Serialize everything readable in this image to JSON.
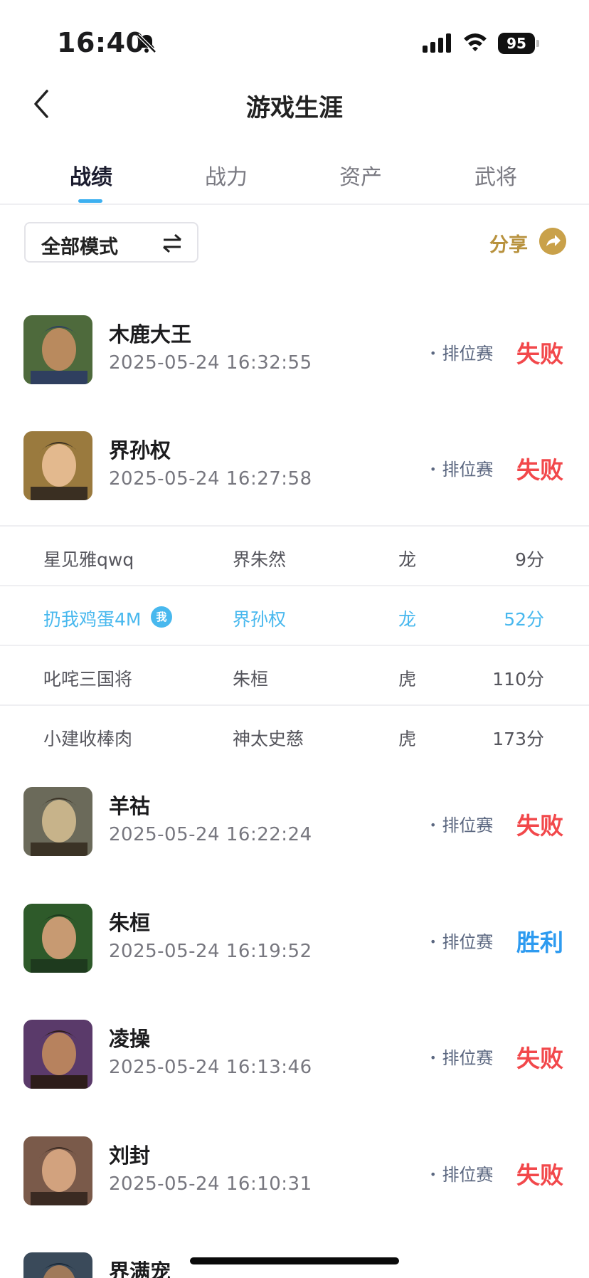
{
  "status_bar": {
    "time": "16:40",
    "battery": "95"
  },
  "header": {
    "title": "游戏生涯"
  },
  "tabs": [
    {
      "label": "战绩",
      "active": true
    },
    {
      "label": "战力",
      "active": false
    },
    {
      "label": "资产",
      "active": false
    },
    {
      "label": "武将",
      "active": false
    }
  ],
  "filter": {
    "mode_label": "全部模式",
    "share_label": "分享"
  },
  "records": [
    {
      "hero": "木鹿大王",
      "datetime": "2025-05-24 16:32:55",
      "match_type": "排位赛",
      "result": "失败",
      "outcome": "lose",
      "avatar_colors": [
        "#4e6a3c",
        "#b98a5e",
        "#2f3f5f"
      ]
    },
    {
      "hero": "界孙权",
      "datetime": "2025-05-24 16:27:58",
      "match_type": "排位赛",
      "result": "失败",
      "outcome": "lose",
      "avatar_colors": [
        "#9a7a3e",
        "#e3b98e",
        "#3a2f22"
      ]
    },
    {
      "hero": "羊祜",
      "datetime": "2025-05-24 16:22:24",
      "match_type": "排位赛",
      "result": "失败",
      "outcome": "lose",
      "avatar_colors": [
        "#6b6a5a",
        "#c7b38a",
        "#3b3326"
      ]
    },
    {
      "hero": "朱桓",
      "datetime": "2025-05-24 16:19:52",
      "match_type": "排位赛",
      "result": "胜利",
      "outcome": "win",
      "avatar_colors": [
        "#2e5a2a",
        "#c79a72",
        "#1e3a1e"
      ]
    },
    {
      "hero": "凌操",
      "datetime": "2025-05-24 16:13:46",
      "match_type": "排位赛",
      "result": "失败",
      "outcome": "lose",
      "avatar_colors": [
        "#5a3a6a",
        "#b7825e",
        "#2d1d1a"
      ]
    },
    {
      "hero": "刘封",
      "datetime": "2025-05-24 16:10:31",
      "match_type": "排位赛",
      "result": "失败",
      "outcome": "lose",
      "avatar_colors": [
        "#7a5a4a",
        "#d2a27e",
        "#3a2a22"
      ]
    },
    {
      "hero": "界满宠",
      "datetime": "",
      "match_type": "",
      "result": "",
      "outcome": "",
      "avatar_colors": [
        "#3a4a5a",
        "#a07a5a",
        "#1a2a3a"
      ]
    }
  ],
  "detail": {
    "my_badge": "我",
    "players": [
      {
        "name": "星见雅qwq",
        "hero": "界朱然",
        "faction": "龙",
        "score": "9分",
        "is_me": false
      },
      {
        "name": "扔我鸡蛋4M",
        "hero": "界孙权",
        "faction": "龙",
        "score": "52分",
        "is_me": true
      },
      {
        "name": "叱咤三国将",
        "hero": "朱桓",
        "faction": "虎",
        "score": "110分",
        "is_me": false
      },
      {
        "name": "小建收棒肉",
        "hero": "神太史慈",
        "faction": "虎",
        "score": "173分",
        "is_me": false
      }
    ]
  },
  "colors": {
    "accent": "#3db0f0",
    "lose": "#f2484b",
    "win": "#2e9bf0",
    "share": "#b8923e"
  }
}
